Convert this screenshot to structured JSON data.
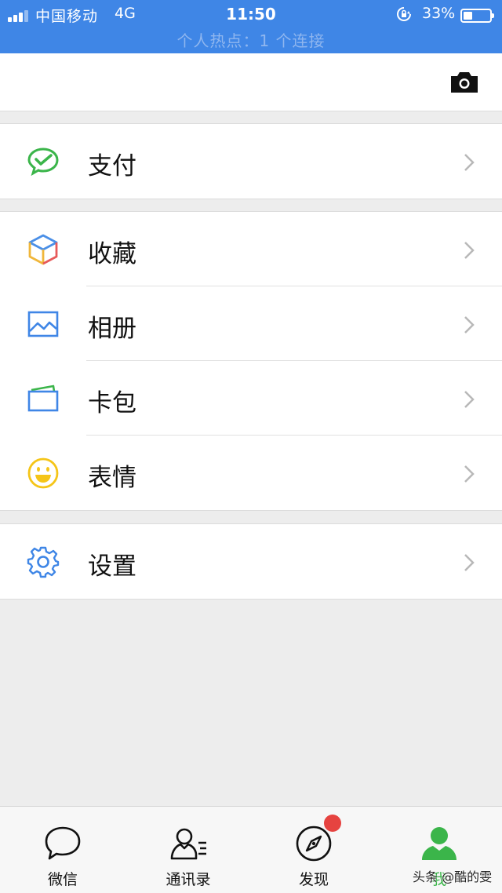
{
  "status_bar": {
    "carrier": "中国移动",
    "network": "4G",
    "time": "11:50",
    "battery_percent_text": "33%",
    "battery_level": 0.33,
    "hotspot_text": "个人热点：1 个连接",
    "background_color": "#3f86e6"
  },
  "header": {
    "camera_icon": "camera-icon"
  },
  "groups": [
    {
      "items": [
        {
          "label": "支付",
          "icon": "wechat-pay-icon",
          "color": "#3bb54a"
        }
      ]
    },
    {
      "items": [
        {
          "label": "收藏",
          "icon": "favorites-cube-icon",
          "color": "#f0b63a"
        },
        {
          "label": "相册",
          "icon": "album-picture-icon",
          "color": "#3f86e6"
        },
        {
          "label": "卡包",
          "icon": "card-wallet-icon",
          "color": "#3f86e6"
        },
        {
          "label": "表情",
          "icon": "smiley-face-icon",
          "color": "#f5c518"
        }
      ]
    },
    {
      "items": [
        {
          "label": "设置",
          "icon": "gear-icon",
          "color": "#3f86e6"
        }
      ]
    }
  ],
  "tab_bar": {
    "tabs": [
      {
        "label": "微信",
        "icon": "chat-bubble-icon"
      },
      {
        "label": "通讯录",
        "icon": "contacts-icon"
      },
      {
        "label": "发现",
        "icon": "compass-icon",
        "badge": true
      },
      {
        "label": "我",
        "icon": "person-icon",
        "active": true,
        "active_color": "#3bb54a"
      }
    ]
  },
  "watermark": "头条 @酷的雯"
}
